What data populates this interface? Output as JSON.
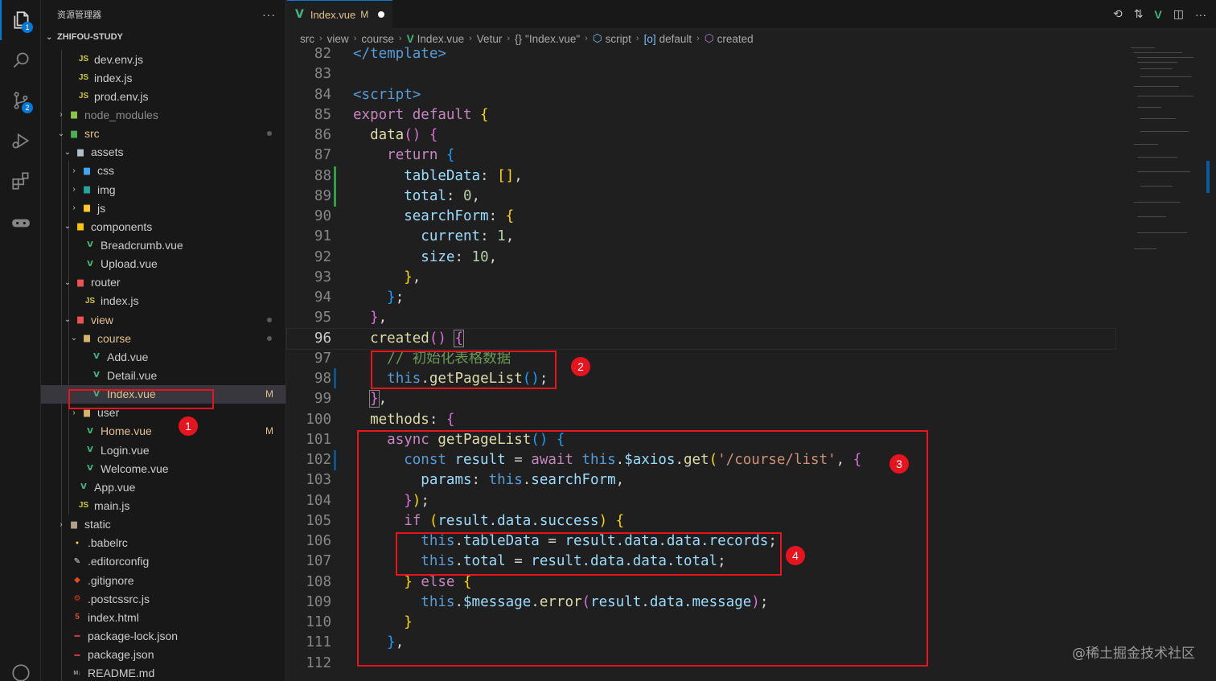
{
  "activity_bar": {
    "badges": {
      "explorer": "1",
      "scm": "2"
    }
  },
  "sidebar": {
    "title": "资源管理器",
    "more": "···",
    "project": "ZHIFOU-STUDY",
    "items": [
      {
        "label": "dev.env.js",
        "icon": "JS"
      },
      {
        "label": "index.js",
        "icon": "JS"
      },
      {
        "label": "prod.env.js",
        "icon": "JS"
      },
      {
        "label": "node_modules"
      },
      {
        "label": "src"
      },
      {
        "label": "assets"
      },
      {
        "label": "css"
      },
      {
        "label": "img"
      },
      {
        "label": "js"
      },
      {
        "label": "components"
      },
      {
        "label": "Breadcrumb.vue"
      },
      {
        "label": "Upload.vue"
      },
      {
        "label": "router"
      },
      {
        "label": "index.js",
        "icon": "JS"
      },
      {
        "label": "view"
      },
      {
        "label": "course"
      },
      {
        "label": "Add.vue"
      },
      {
        "label": "Detail.vue"
      },
      {
        "label": "Index.vue",
        "status": "M"
      },
      {
        "label": "user"
      },
      {
        "label": "Home.vue",
        "status": "M"
      },
      {
        "label": "Login.vue"
      },
      {
        "label": "Welcome.vue"
      },
      {
        "label": "App.vue"
      },
      {
        "label": "main.js",
        "icon": "JS"
      },
      {
        "label": "static"
      },
      {
        "label": ".babelrc"
      },
      {
        "label": ".editorconfig"
      },
      {
        "label": ".gitignore"
      },
      {
        "label": ".postcssrc.js"
      },
      {
        "label": "index.html"
      },
      {
        "label": "package-lock.json"
      },
      {
        "label": "package.json"
      },
      {
        "label": "README.md"
      }
    ]
  },
  "editor": {
    "tab": {
      "label": "Index.vue",
      "status": "M"
    },
    "breadcrumbs": [
      "src",
      "view",
      "course",
      "Index.vue",
      "Vetur",
      "\"Index.vue\"",
      "script",
      "default",
      "created"
    ],
    "line_numbers": [
      "82",
      "83",
      "84",
      "85",
      "86",
      "87",
      "88",
      "89",
      "90",
      "91",
      "92",
      "93",
      "94",
      "95",
      "96",
      "97",
      "98",
      "99",
      "100",
      "101",
      "102",
      "103",
      "104",
      "105",
      "106",
      "107",
      "108",
      "109",
      "110",
      "111",
      "112"
    ],
    "current_line": "96",
    "code": {
      "l82": "</template>",
      "l84": "<script>",
      "l85_kw": "export default",
      "l86_fn": "data",
      "l87_kw": "return",
      "l88_pr": "tableData",
      "l89_pr": "total",
      "l89_nu": "0",
      "l90_pr": "searchForm",
      "l91_pr": "current",
      "l91_nu": "1",
      "l92_pr": "size",
      "l92_nu": "10",
      "l96_fn": "created",
      "l97_cm": "// 初始化表格数据",
      "l98_th": "this",
      "l98_fn": "getPageList",
      "l100_fn": "methods",
      "l101_kw": "async",
      "l101_fn": "getPageList",
      "l102_kw": "const",
      "l102_v": "result",
      "l102_aw": "await",
      "l102_th": "this",
      "l102_p": "$axios",
      "l102_fn": "get",
      "l102_st": "'/course/list'",
      "l103_pr": "params",
      "l103_th": "this",
      "l103_p": "searchForm",
      "l105_kw": "if",
      "l105_p": "result.data.success",
      "l106_th": "this",
      "l106_p": "tableData",
      "l106_r": "result.data.data.records",
      "l107_th": "this",
      "l107_p": "total",
      "l107_r": "result.data.data.total",
      "l108_kw": "else",
      "l109_th": "this",
      "l109_p": "$message",
      "l109_fn": "error",
      "l109_r": "result.data.message"
    }
  },
  "annotations": [
    "1",
    "2",
    "3",
    "4"
  ],
  "watermark": "@稀土掘金技术社区"
}
